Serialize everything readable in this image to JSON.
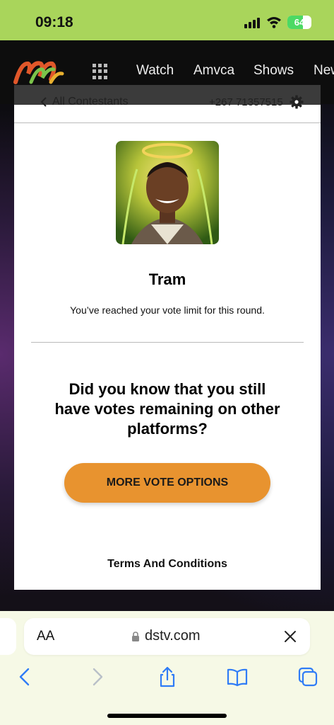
{
  "status_bar": {
    "time": "09:18",
    "battery": "64"
  },
  "header": {
    "nav": [
      "Watch",
      "Amvca",
      "Shows",
      "New"
    ]
  },
  "modal": {
    "back_label": "All Contestants",
    "phone": "+267 71357515",
    "contestant_name": "Tram",
    "limit_message": "You’ve reached your vote limit for this round.",
    "question": "Did you know that you still have votes remaining on other platforms?",
    "cta_label": "MORE VOTE OPTIONS",
    "terms_label": "Terms And Conditions"
  },
  "browser": {
    "text_size_label": "AA",
    "url": "dstv.com"
  },
  "colors": {
    "status_bg": "#a9d55b",
    "cta": "#e8932f",
    "safari_bg": "#f6f9e6",
    "ios_blue": "#2f7cf6"
  },
  "icons": [
    "grid-icon",
    "chevron-left-icon",
    "gear-icon",
    "lock-icon",
    "close-icon",
    "back-icon",
    "forward-icon",
    "share-icon",
    "bookmarks-icon",
    "tabs-icon"
  ]
}
